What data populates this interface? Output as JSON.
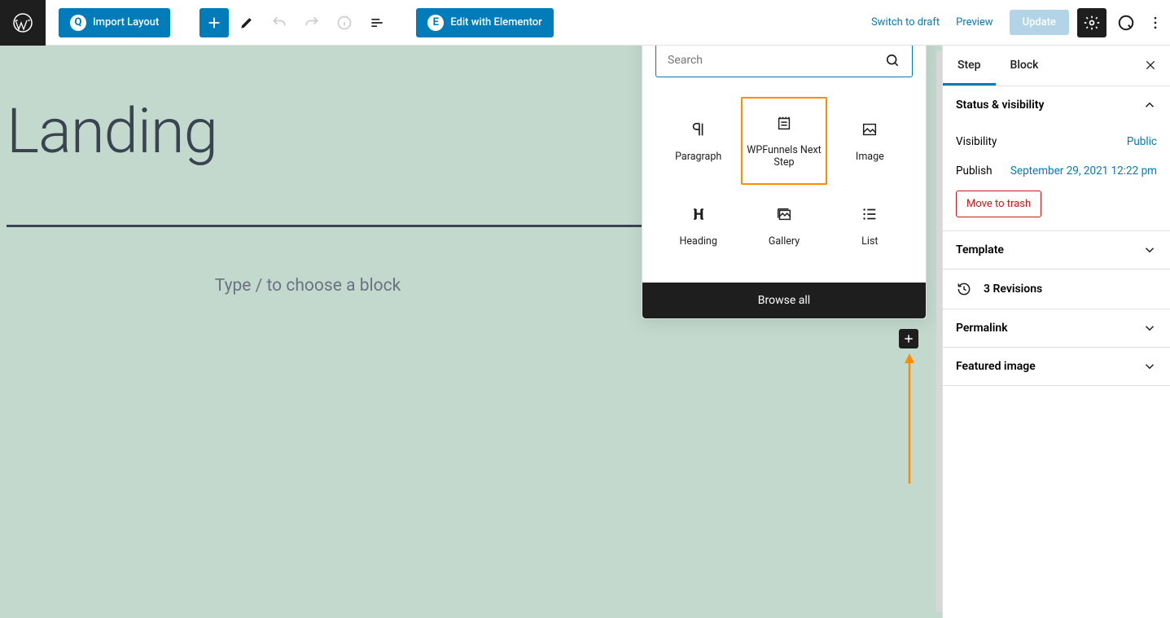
{
  "toolbar": {
    "import_layout": "Import Layout",
    "edit_elementor": "Edit with Elementor",
    "switch_draft": "Switch to draft",
    "preview": "Preview",
    "update": "Update"
  },
  "canvas": {
    "title": "Landing",
    "placeholder": "Type / to choose a block"
  },
  "inserter": {
    "search_placeholder": "Search",
    "blocks": [
      {
        "label": "Paragraph"
      },
      {
        "label": "WPFunnels Next Step"
      },
      {
        "label": "Image"
      },
      {
        "label": "Heading"
      },
      {
        "label": "Gallery"
      },
      {
        "label": "List"
      }
    ],
    "browse_all": "Browse all"
  },
  "sidebar": {
    "tab_step": "Step",
    "tab_block": "Block",
    "status_visibility": "Status & visibility",
    "visibility_label": "Visibility",
    "visibility_value": "Public",
    "publish_label": "Publish",
    "publish_value": "September 29, 2021 12:22 pm",
    "move_trash": "Move to trash",
    "template": "Template",
    "revisions": "3 Revisions",
    "permalink": "Permalink",
    "featured_image": "Featured image"
  }
}
